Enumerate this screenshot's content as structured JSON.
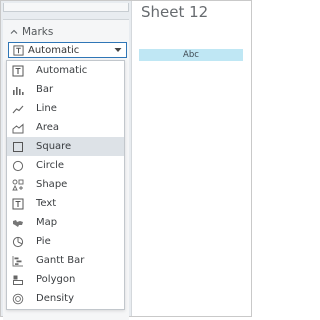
{
  "marks_panel": {
    "header_label": "Marks",
    "mark_type_select": {
      "value": "Automatic"
    },
    "dropdown_items": [
      {
        "label": "Automatic",
        "icon": "automatic-mark-icon"
      },
      {
        "label": "Bar",
        "icon": "bar-mark-icon"
      },
      {
        "label": "Line",
        "icon": "line-mark-icon"
      },
      {
        "label": "Area",
        "icon": "area-mark-icon"
      },
      {
        "label": "Square",
        "icon": "square-mark-icon",
        "highlighted": true
      },
      {
        "label": "Circle",
        "icon": "circle-mark-icon"
      },
      {
        "label": "Shape",
        "icon": "shape-mark-icon"
      },
      {
        "label": "Text",
        "icon": "text-mark-icon"
      },
      {
        "label": "Map",
        "icon": "map-mark-icon"
      },
      {
        "label": "Pie",
        "icon": "pie-mark-icon"
      },
      {
        "label": "Gantt Bar",
        "icon": "gantt-bar-mark-icon"
      },
      {
        "label": "Polygon",
        "icon": "polygon-mark-icon"
      },
      {
        "label": "Density",
        "icon": "density-mark-icon"
      }
    ]
  },
  "sheet": {
    "title": "Sheet 12",
    "cell_text": "Abc"
  },
  "colors": {
    "accent": "#2f76b6",
    "highlight_row": "#dde2e7",
    "cell_fill": "#bfe7f4",
    "panel_bg": "#e8ecf0"
  }
}
